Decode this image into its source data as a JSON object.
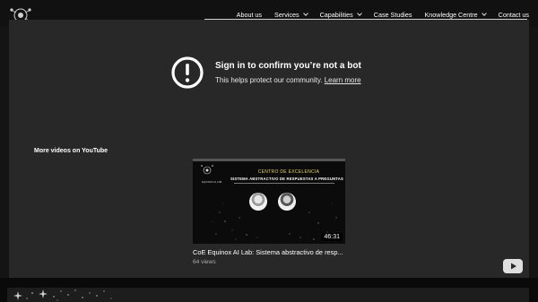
{
  "nav": {
    "items": [
      {
        "label": "About us",
        "has_dropdown": false
      },
      {
        "label": "Services",
        "has_dropdown": true
      },
      {
        "label": "Capabilities",
        "has_dropdown": true
      },
      {
        "label": "Case Studies",
        "has_dropdown": false
      },
      {
        "label": "Knowledge Centre",
        "has_dropdown": true
      },
      {
        "label": "Contact us",
        "has_dropdown": false
      }
    ]
  },
  "youtube": {
    "warning_title": "Sign in to confirm you’re not a bot",
    "warning_text": "This helps protect our community.",
    "learn_more": "Learn more",
    "more_videos_label": "More videos on YouTube",
    "video": {
      "title": "CoE Equinox AI Lab: Sistema abstractivo de resp...",
      "views": "64 views",
      "duration": "46:31",
      "thumbnail": {
        "heading": "CENTRO DE EXCELENCIA",
        "subheading": "SISTEMA ABSTRACTIVO DE RESPUESTAS A PREGUNTAS",
        "logo_text": "EQUINOX AI LAB"
      }
    }
  },
  "colors": {
    "page_bg": "#141414",
    "embed_bg": "#282828",
    "accent_yellow": "#e8d56b",
    "text_white": "#ffffff",
    "text_muted": "#aaaaaa"
  }
}
